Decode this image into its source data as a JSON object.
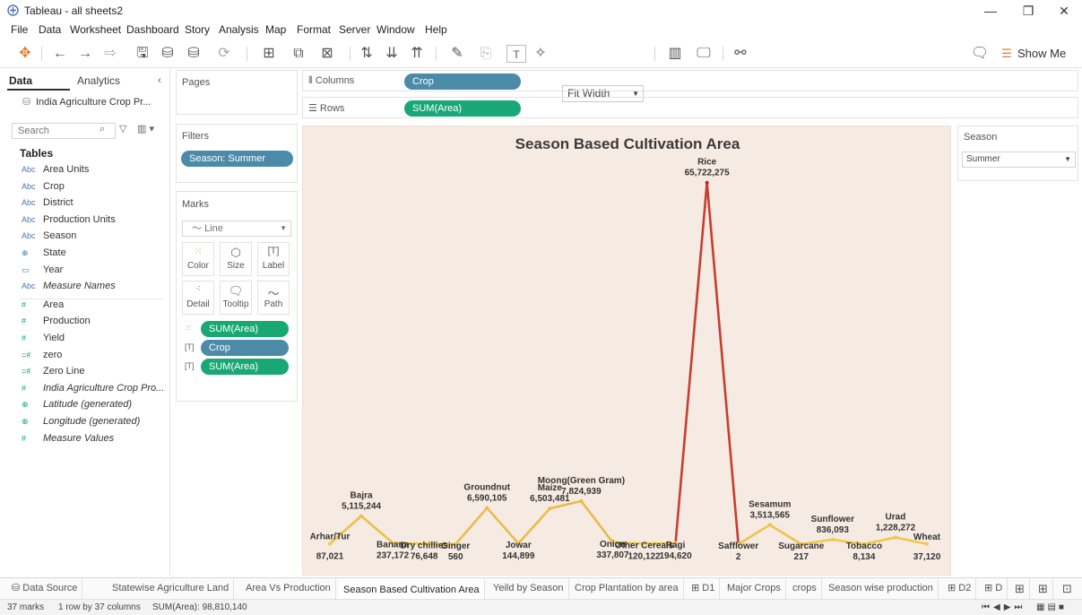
{
  "window": {
    "title": "Tableau - all sheets2",
    "minimize": "—",
    "maximize": "❐",
    "close": "✕"
  },
  "menu": [
    "File",
    "Data",
    "Worksheet",
    "Dashboard",
    "Story",
    "Analysis",
    "Map",
    "Format",
    "Server",
    "Window",
    "Help"
  ],
  "toolbar": {
    "fit": "Fit Width",
    "show_me": "Show Me"
  },
  "data_pane": {
    "tab_data": "Data",
    "tab_analytics": "Analytics",
    "datasource": "India Agriculture Crop Pr...",
    "search_placeholder": "Search",
    "tables_heading": "Tables",
    "fields": [
      {
        "type": "Abc",
        "name": "Area Units",
        "kind": "dim"
      },
      {
        "type": "Abc",
        "name": "Crop",
        "kind": "dim"
      },
      {
        "type": "Abc",
        "name": "District",
        "kind": "dim"
      },
      {
        "type": "Abc",
        "name": "Production Units",
        "kind": "dim"
      },
      {
        "type": "Abc",
        "name": "Season",
        "kind": "dim"
      },
      {
        "type": "⊕",
        "name": "State",
        "kind": "dim"
      },
      {
        "type": "▭",
        "name": "Year",
        "kind": "dim"
      },
      {
        "type": "Abc",
        "name": "Measure Names",
        "kind": "dim",
        "italic": true
      },
      {
        "type": "#",
        "name": "Area",
        "kind": "meas"
      },
      {
        "type": "#",
        "name": "Production",
        "kind": "meas"
      },
      {
        "type": "#",
        "name": "Yield",
        "kind": "meas"
      },
      {
        "type": "=#",
        "name": "zero",
        "kind": "meas"
      },
      {
        "type": "=#",
        "name": "Zero Line",
        "kind": "meas"
      },
      {
        "type": "#",
        "name": "India Agriculture Crop Pro...",
        "kind": "meas",
        "italic": true
      },
      {
        "type": "⊕",
        "name": "Latitude (generated)",
        "kind": "meas",
        "italic": true
      },
      {
        "type": "⊕",
        "name": "Longitude (generated)",
        "kind": "meas",
        "italic": true
      },
      {
        "type": "#",
        "name": "Measure Values",
        "kind": "meas",
        "italic": true
      }
    ]
  },
  "pages": {
    "title": "Pages"
  },
  "filters": {
    "title": "Filters",
    "pill": "Season: Summer"
  },
  "marks": {
    "title": "Marks",
    "type": "Line",
    "buttons": [
      "Color",
      "Size",
      "Label",
      "Detail",
      "Tooltip",
      "Path"
    ],
    "pills": [
      {
        "label": "SUM(Area)",
        "color": "green",
        "icon": "color-icon"
      },
      {
        "label": "Crop",
        "color": "blue",
        "icon": "label-icon"
      },
      {
        "label": "SUM(Area)",
        "color": "green",
        "icon": "label-icon"
      }
    ]
  },
  "shelves": {
    "columns_label": "Columns",
    "columns_pill": "Crop",
    "rows_label": "Rows",
    "rows_pill": "SUM(Area)"
  },
  "season_filter": {
    "title": "Season",
    "value": "Summer"
  },
  "chart_data": {
    "type": "line",
    "title": "Season Based Cultivation Area",
    "categories": [
      "Arhar/Tur",
      "Bajra",
      "Banana",
      "Dry chillies",
      "Ginger",
      "Groundnut",
      "Jowar",
      "Maize",
      "Moong(Green Gram)",
      "Onion",
      "Other Cereals",
      "Ragi",
      "Rice",
      "Safflower",
      "Sesamum",
      "Sugarcane",
      "Sunflower",
      "Tobacco",
      "Urad",
      "Wheat"
    ],
    "values": [
      87021,
      5115244,
      237172,
      76648,
      560,
      6590105,
      144899,
      6503481,
      7824939,
      337807,
      120122,
      194620,
      65722275,
      2,
      3513565,
      217,
      836093,
      8134,
      1228272,
      37120
    ],
    "value_labels": [
      "87,021",
      "5,115,244",
      "237,172",
      "76,648",
      "560",
      "6,590,105",
      "144,899",
      "6,503,481",
      "7,824,939",
      "337,807",
      "120,122",
      "194,620",
      "65,722,275",
      "2",
      "3,513,565",
      "217",
      "836,093",
      "8,134",
      "1,228,272",
      "37,120"
    ],
    "ylim": [
      0,
      66000000
    ],
    "grid": false,
    "color_low": "#f2c94c",
    "color_high": "#c0242b"
  },
  "sheet_tabs": [
    {
      "label": "Data Source",
      "icon": "database-icon"
    },
    {
      "label": "Statewise Agriculture Land"
    },
    {
      "label": "Area Vs Production"
    },
    {
      "label": "Season Based Cultivation Area",
      "active": true
    },
    {
      "label": "Yeild by Season"
    },
    {
      "label": "Crop Plantation by area"
    },
    {
      "label": "D1",
      "icon": "dashboard-icon"
    },
    {
      "label": "Major Crops"
    },
    {
      "label": "crops"
    },
    {
      "label": "Season wise production"
    },
    {
      "label": "D2",
      "icon": "dashboard-icon"
    },
    {
      "label": "D",
      "icon": "dashboard-icon"
    }
  ],
  "status": {
    "marks": "37 marks",
    "dims": "1 row by 37 columns",
    "sum": "SUM(Area): 98,810,140"
  }
}
